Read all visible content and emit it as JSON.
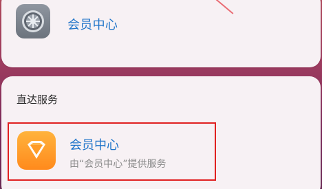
{
  "top_result": {
    "icon": "settings-gear-icon",
    "label": "会员中心"
  },
  "direct_services": {
    "title": "直达服务",
    "item": {
      "icon": "diamond-icon",
      "title": "会员中心",
      "subtitle": "由“会员中心”提供服务"
    }
  },
  "colors": {
    "link_blue": "#1f74c9",
    "highlight_red": "#e02020",
    "card_bg": "#f7f1f4"
  }
}
